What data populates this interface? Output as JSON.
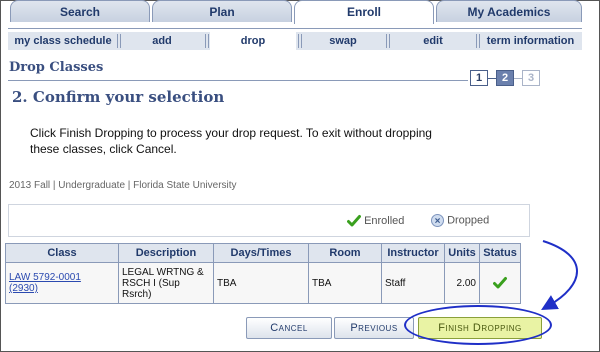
{
  "tabs": [
    "Search",
    "Plan",
    "Enroll",
    "My Academics"
  ],
  "active_tab": "Enroll",
  "subnav": [
    "my class schedule",
    "add",
    "drop",
    "swap",
    "edit",
    "term information"
  ],
  "active_subnav": "drop",
  "page_title": "Drop Classes",
  "steps": [
    "1",
    "2",
    "3"
  ],
  "current_step": "2",
  "heading": "2.  Confirm your selection",
  "instructions": "Click Finish Dropping to process your drop request. To exit without dropping these classes, click Cancel.",
  "term_info": "2013 Fall | Undergraduate | Florida State University",
  "legend": {
    "enrolled": "Enrolled",
    "dropped": "Dropped",
    "enrolled_icon": "green-checkmark-icon",
    "dropped_icon": "blue-x-circle-icon"
  },
  "table": {
    "headers": [
      "Class",
      "Description",
      "Days/Times",
      "Room",
      "Instructor",
      "Units",
      "Status"
    ],
    "rows": [
      {
        "class": "LAW 5792-0001",
        "class_nbr": "(2930)",
        "description": "LEGAL WRTNG & RSCH I (Sup Rsrch)",
        "days_times": "TBA",
        "room": "TBA",
        "instructor": "Staff",
        "units": "2.00",
        "status_icon": "green-checkmark-icon"
      }
    ]
  },
  "buttons": {
    "cancel": "Cancel",
    "previous": "Previous",
    "finish": "Finish Dropping"
  },
  "colors": {
    "nav_text": "#213a6b",
    "accent_blue": "#3a4f80",
    "finish_button_bg": "#e9f3a4",
    "annotation_blue": "#1f2fc7",
    "check_green": "#3aa01e"
  }
}
